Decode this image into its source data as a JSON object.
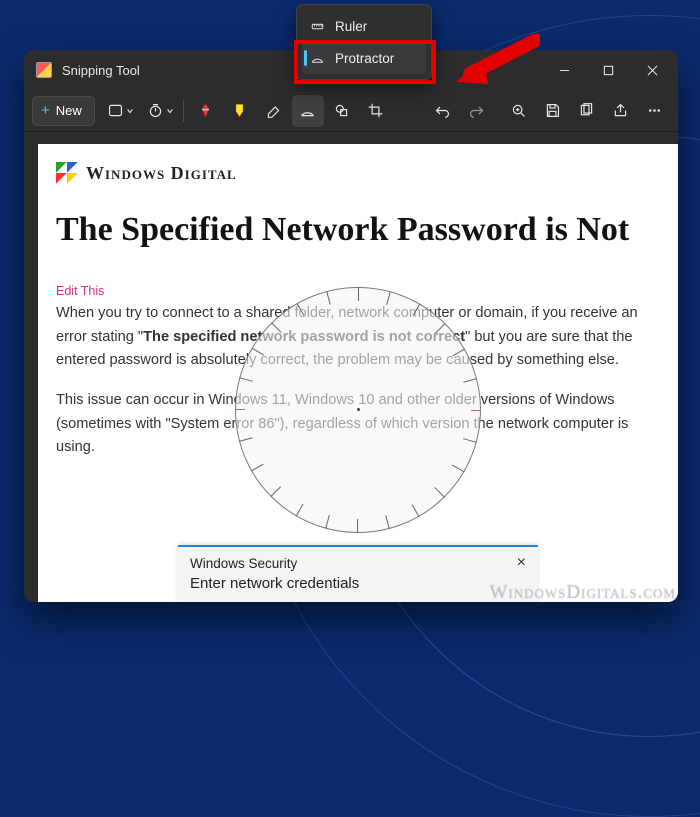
{
  "titlebar": {
    "title": "Snipping Tool"
  },
  "toolbar": {
    "new_label": "New"
  },
  "dropdown": {
    "items": [
      {
        "label": "Ruler"
      },
      {
        "label": "Protractor"
      }
    ],
    "selected_index": 1
  },
  "content": {
    "brand": "Windows Digital",
    "headline": "The Specified Network Password is Not",
    "edit_link": "Edit This",
    "para1_pre": "When you try to connect to a shared folder, network computer or domain, if you receive an error stating \"",
    "para1_bold": "The specified network password is not correct",
    "para1_post": "\" but you are sure that the entered password is absolutely correct, the problem may be caused by something else.",
    "para2": "This issue can occur in Windows 11, Windows 10 and other older versions of Windows (sometimes with \"System error 86\"), regardless of which version the network computer is using."
  },
  "security_dialog": {
    "title": "Windows Security",
    "subtitle": "Enter network credentials"
  },
  "watermark": "WindowsDigitals.com"
}
